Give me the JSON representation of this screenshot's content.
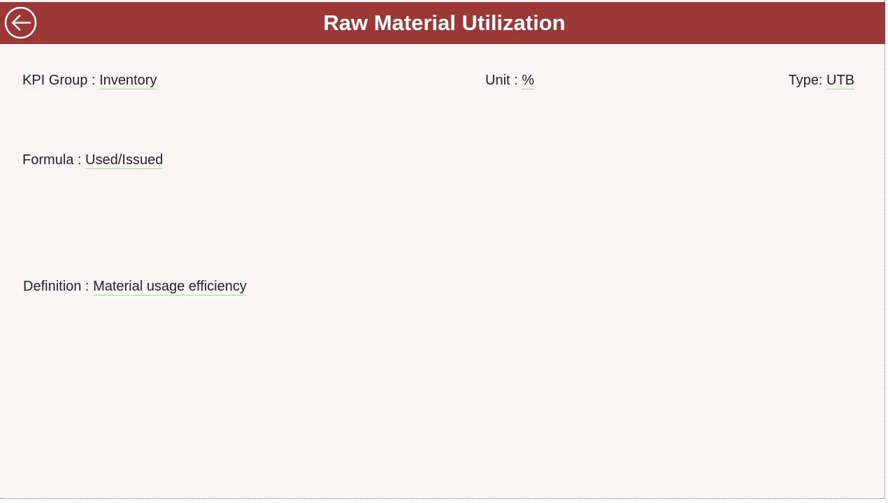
{
  "header": {
    "title": "Raw Material Utilization",
    "back_icon": "arrow-left-circle-icon",
    "background_color": "#9b3734"
  },
  "fields": {
    "kpi_group": {
      "label": "KPI Group : ",
      "value": "Inventory"
    },
    "unit": {
      "label": "Unit : ",
      "value": "%"
    },
    "type": {
      "label": "Type: ",
      "value": "UTB"
    },
    "formula": {
      "label": "Formula : ",
      "value": "Used/Issued"
    },
    "definition": {
      "label": "Definition : ",
      "value": "Material usage efficiency"
    }
  },
  "colors": {
    "page_background": "#fbf6f5",
    "value_underline": "#a6d98d",
    "text": "#1f1f2e"
  }
}
